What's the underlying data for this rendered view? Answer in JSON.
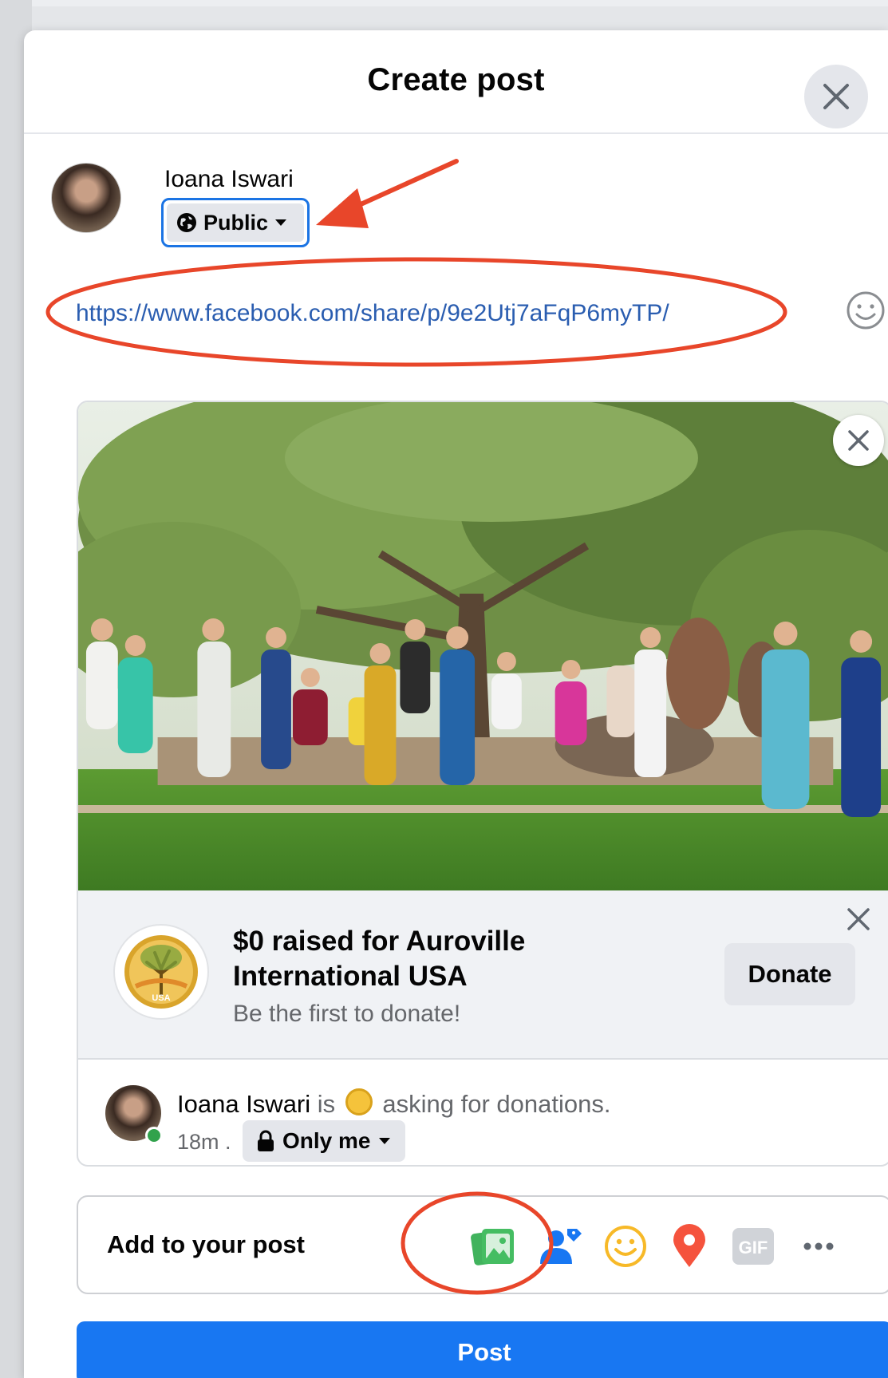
{
  "modal": {
    "title": "Create post"
  },
  "author": {
    "name": "Ioana Iswari",
    "privacy_label": "Public"
  },
  "composer": {
    "text": "https://www.facebook.com/share/p/9e2Utj7aFqP6myTP/"
  },
  "fundraiser": {
    "title": "$0 raised for Auroville International USA",
    "subtitle": "Be the first to donate!",
    "donate_label": "Donate",
    "logo_text": "USA"
  },
  "attribution": {
    "name": "Ioana Iswari",
    "is_text": "is",
    "action_text": "asking for donations.",
    "time": "18m",
    "separator": ".",
    "audience_label": "Only me"
  },
  "add_to_post": {
    "label": "Add to your post",
    "tools": [
      "photo-video-icon",
      "tag-people-icon",
      "feeling-icon",
      "location-icon",
      "gif-icon",
      "more-icon"
    ],
    "gif_text": "GIF"
  },
  "post_button_label": "Post",
  "colors": {
    "primary": "#1877f2",
    "annotation": "#e8462a",
    "link": "#2a5db0"
  }
}
